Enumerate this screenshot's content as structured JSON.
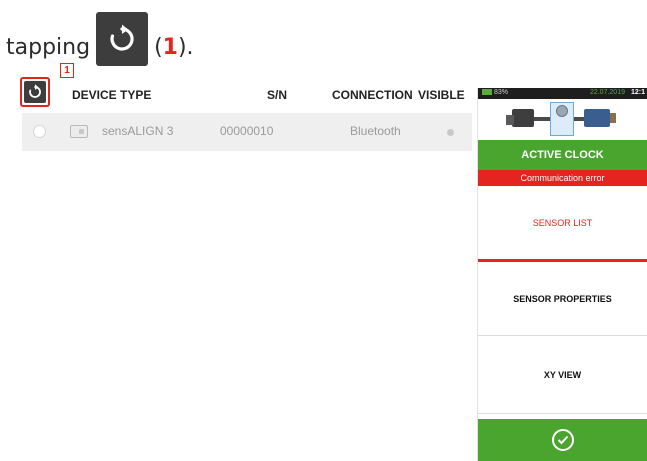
{
  "caption": {
    "prefix": "tapping",
    "paren_open": "(",
    "callout_number": "1",
    "paren_close": ")."
  },
  "table": {
    "refresh_icon": "refresh-icon",
    "callout_number": "1",
    "columns": [
      "DEVICE TYPE",
      "S/N",
      "CONNECTION",
      "VISIBLE"
    ],
    "rows": [
      {
        "device_type": "sensALIGN 3",
        "serial": "00000010",
        "connection": "Bluetooth",
        "visible": false
      }
    ]
  },
  "phone": {
    "status": {
      "battery": "83%",
      "date": "22.07.2019",
      "time": "12:1"
    },
    "active_clock_label": "ACTIVE CLOCK",
    "error_text": "Communication error",
    "menu": [
      {
        "label": "SENSOR LIST",
        "active": true
      },
      {
        "label": "SENSOR PROPERTIES",
        "active": false
      },
      {
        "label": "XY VIEW",
        "active": false
      }
    ],
    "confirm_icon": "check-circle-icon"
  },
  "colors": {
    "accent_red": "#e3261c",
    "green": "#4aa52e",
    "dark_button": "#3d3d3d"
  }
}
